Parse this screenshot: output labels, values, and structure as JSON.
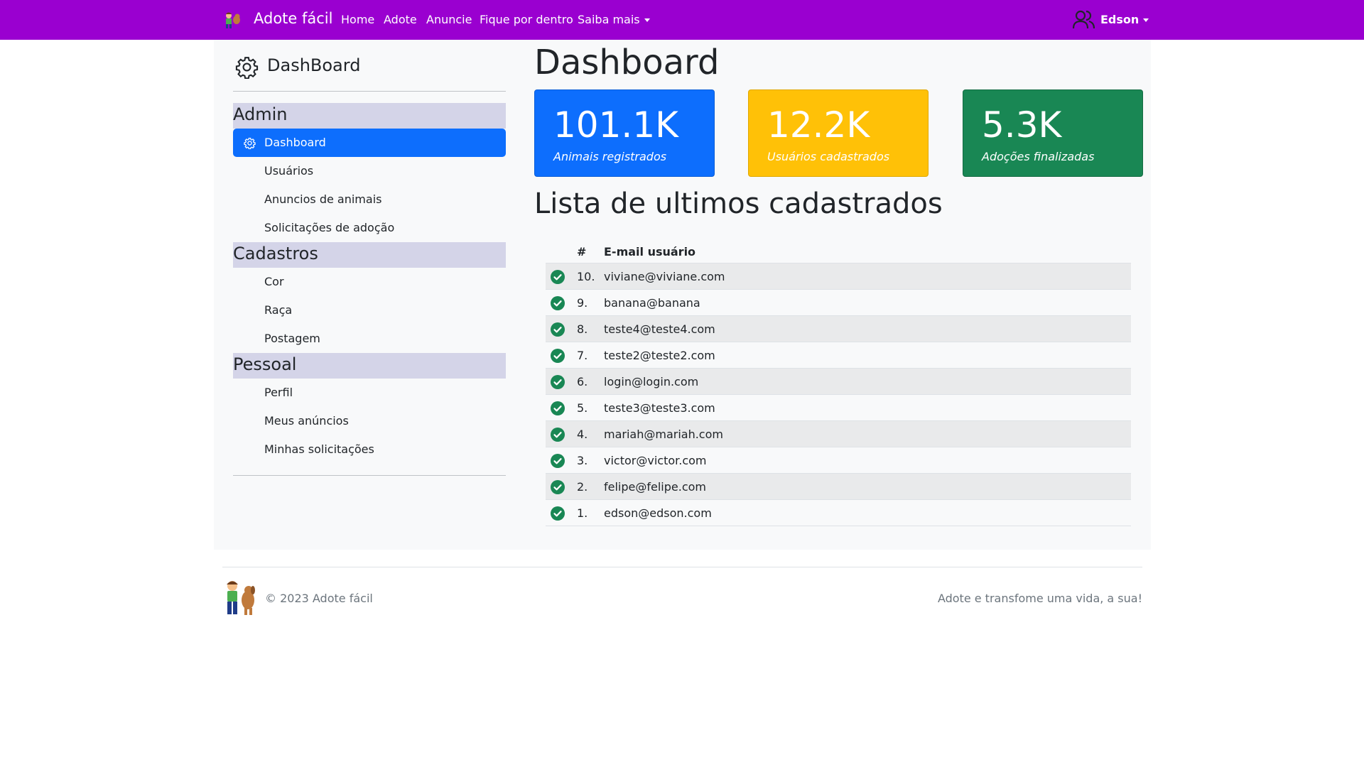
{
  "navbar": {
    "brand": "Adote fácil",
    "links": [
      "Home",
      "Adote",
      "Anuncie",
      "Fique por dentro",
      "Saiba mais"
    ],
    "user": "Edson",
    "bg_color": "#9a00d0"
  },
  "sidebar": {
    "title": "DashBoard",
    "sections": [
      {
        "header": "Admin",
        "items": [
          "Dashboard",
          "Usuários",
          "Anuncios de animais",
          "Solicitações de adoção"
        ]
      },
      {
        "header": "Cadastros",
        "items": [
          "Cor",
          "Raça",
          "Postagem"
        ]
      },
      {
        "header": "Pessoal",
        "items": [
          "Perfil",
          "Meus anúncios",
          "Minhas solicitações"
        ]
      }
    ],
    "active_item": "Dashboard",
    "active_color": "#0d6efd"
  },
  "main": {
    "title": "Dashboard",
    "cards": [
      {
        "value": "101.1K",
        "label": "Animais registrados",
        "color": "#0d6efd"
      },
      {
        "value": "12.2K",
        "label": "Usuários cadastrados",
        "color": "#ffc107"
      },
      {
        "value": "5.3K",
        "label": "Adoções finalizadas",
        "color": "#198754"
      }
    ],
    "list_title": "Lista de ultimos cadastrados",
    "table": {
      "headers": [
        "#",
        "E-mail usuário"
      ],
      "rows": [
        {
          "num": "10.",
          "email": "viviane@viviane.com"
        },
        {
          "num": "9.",
          "email": "banana@banana"
        },
        {
          "num": "8.",
          "email": "teste4@teste4.com"
        },
        {
          "num": "7.",
          "email": "teste2@teste2.com"
        },
        {
          "num": "6.",
          "email": "login@login.com"
        },
        {
          "num": "5.",
          "email": "teste3@teste3.com"
        },
        {
          "num": "4.",
          "email": "mariah@mariah.com"
        },
        {
          "num": "3.",
          "email": "victor@victor.com"
        },
        {
          "num": "2.",
          "email": "felipe@felipe.com"
        },
        {
          "num": "1.",
          "email": "edson@edson.com"
        }
      ],
      "check_color": "#198754"
    }
  },
  "footer": {
    "copyright": "© 2023 Adote fácil",
    "tagline": "Adote e transfome uma vida, a sua!"
  }
}
